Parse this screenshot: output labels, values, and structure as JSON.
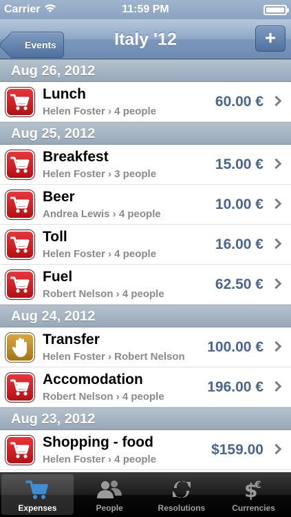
{
  "status_bar": {
    "carrier": "Carrier",
    "time": "11:59 PM",
    "battery_level": 1.0
  },
  "nav": {
    "back_label": "Events",
    "title": "Italy '12",
    "add_label": "+"
  },
  "sections": [
    {
      "date": "Aug 26, 2012",
      "rows": [
        {
          "icon": "cart-icon",
          "title": "Lunch",
          "subtitle": "Helen Foster › 4 people",
          "amount": "60.00 €"
        }
      ]
    },
    {
      "date": "Aug 25, 2012",
      "rows": [
        {
          "icon": "cart-icon",
          "title": "Breakfest",
          "subtitle": "Helen Foster › 3 people",
          "amount": "15.00 €"
        },
        {
          "icon": "cart-icon",
          "title": "Beer",
          "subtitle": "Andrea Lewis › 4 people",
          "amount": "10.00 €"
        },
        {
          "icon": "cart-icon",
          "title": "Toll",
          "subtitle": "Helen Foster › 4 people",
          "amount": "16.00 €"
        },
        {
          "icon": "cart-icon",
          "title": "Fuel",
          "subtitle": "Robert Nelson › 4 people",
          "amount": "62.50 €"
        }
      ]
    },
    {
      "date": "Aug 24, 2012",
      "rows": [
        {
          "icon": "hand-icon",
          "title": "Transfer",
          "subtitle": "Helen Foster › Robert Nelson",
          "amount": "100.00 €"
        },
        {
          "icon": "cart-icon",
          "title": "Accomodation",
          "subtitle": "Robert Nelson › 4 people",
          "amount": "196.00 €"
        }
      ]
    },
    {
      "date": "Aug 23, 2012",
      "rows": [
        {
          "icon": "cart-icon",
          "title": "Shopping - food",
          "subtitle": "Helen Foster › 4 people",
          "amount": "$159.00"
        }
      ]
    }
  ],
  "tabs": [
    {
      "label": "Expenses",
      "icon": "cart-icon",
      "active": true
    },
    {
      "label": "People",
      "icon": "people-icon",
      "active": false
    },
    {
      "label": "Resolutions",
      "icon": "arrows-icon",
      "active": false
    },
    {
      "label": "Currencies",
      "icon": "currency-icon",
      "active": false
    }
  ],
  "colors": {
    "amount": "#4a6590",
    "cart_icon_bg": "#d0201f",
    "hand_icon_bg": "#c48f30",
    "tab_active": "#3e8fd8"
  }
}
